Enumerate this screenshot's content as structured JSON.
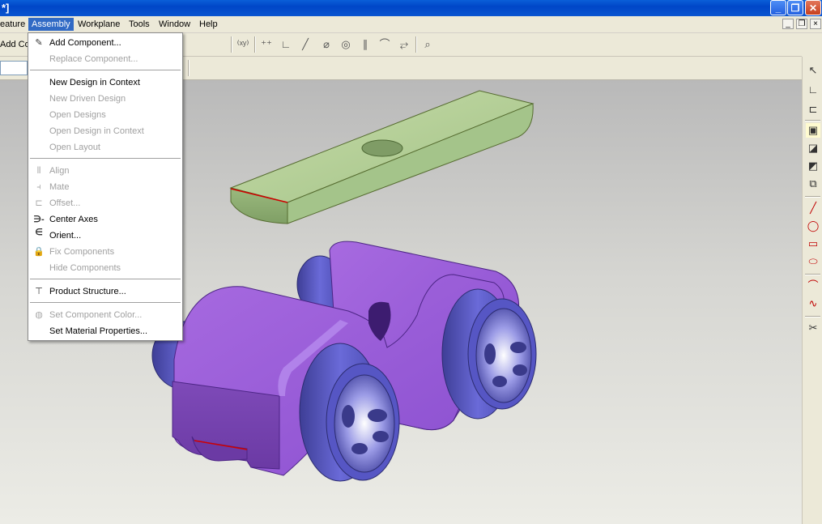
{
  "window": {
    "title_fragment": "*]"
  },
  "menubar": {
    "items": [
      "eature",
      "Assembly",
      "Workplane",
      "Tools",
      "Window",
      "Help"
    ],
    "active": "Assembly"
  },
  "toolbar": {
    "add_label": "Add Co"
  },
  "assembly_menu": {
    "items": [
      {
        "label": "Add Component...",
        "enabled": true,
        "icon": "add-component-icon"
      },
      {
        "label": "Replace Component...",
        "enabled": false,
        "icon": ""
      },
      {
        "label": "New Design in Context",
        "enabled": true,
        "icon": ""
      },
      {
        "label": "New Driven Design",
        "enabled": false,
        "icon": ""
      },
      {
        "label": "Open Designs",
        "enabled": false,
        "icon": ""
      },
      {
        "label": "Open Design in Context",
        "enabled": false,
        "icon": ""
      },
      {
        "label": "Open Layout",
        "enabled": false,
        "icon": ""
      },
      {
        "label": "Align",
        "enabled": false,
        "icon": "align-icon"
      },
      {
        "label": "Mate",
        "enabled": false,
        "icon": "mate-icon"
      },
      {
        "label": "Offset...",
        "enabled": false,
        "icon": "offset-icon"
      },
      {
        "label": "Center Axes",
        "enabled": true,
        "icon": "center-axes-icon"
      },
      {
        "label": "Orient...",
        "enabled": true,
        "icon": ""
      },
      {
        "label": "Fix Components",
        "enabled": false,
        "icon": "fix-components-icon"
      },
      {
        "label": "Hide Components",
        "enabled": false,
        "icon": ""
      },
      {
        "label": "Product Structure...",
        "enabled": true,
        "icon": "product-structure-icon"
      },
      {
        "label": "Set Component Color...",
        "enabled": false,
        "icon": "component-color-icon"
      },
      {
        "label": "Set Material Properties...",
        "enabled": true,
        "icon": ""
      }
    ]
  },
  "colors": {
    "menu_highlight": "#316ac5",
    "part_top": "#a9c98a",
    "part_body": "#9b5fd6",
    "wheel": "#5b5bc8"
  }
}
